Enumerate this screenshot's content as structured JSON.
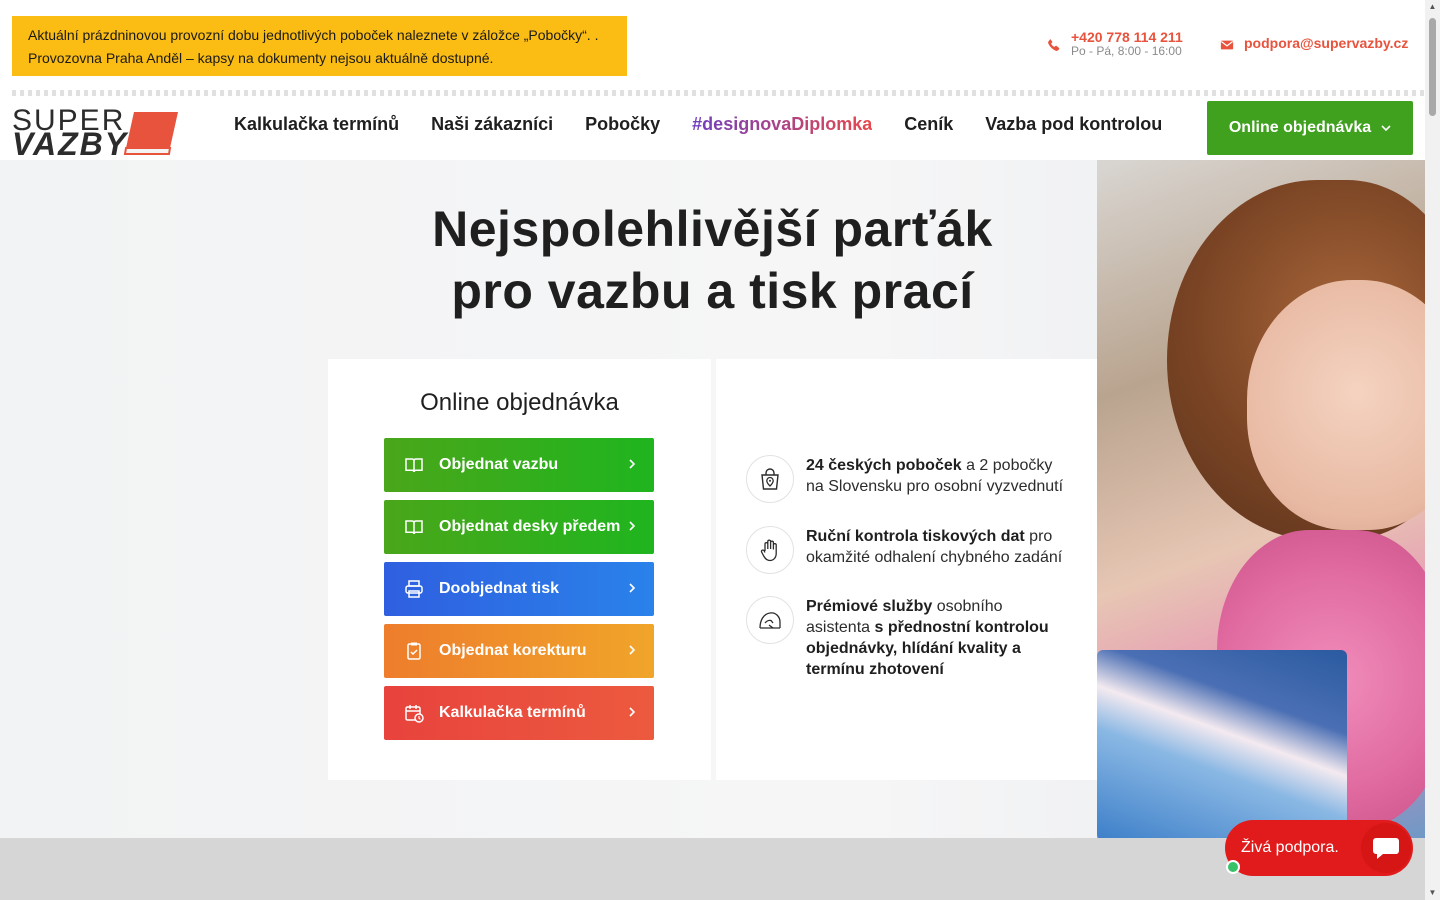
{
  "notice": {
    "line1": "Aktuální prázdninovou provozní dobu jednotlivých poboček naleznete v záložce „Pobočky“. .",
    "line2": "Provozovna Praha Anděl – kapsy na dokumenty nejsou aktuálně dostupné."
  },
  "contact": {
    "phone": "+420 778 114 211",
    "hours": "Po - Pá, 8:00 - 16:00",
    "email": "podpora@supervazby.cz"
  },
  "logo": {
    "line1": "SUPER",
    "line2": "VAZBY"
  },
  "nav": {
    "items": [
      "Kalkulačka termínů",
      "Naši zákazníci",
      "Pobočky",
      "#designovaDiplomka",
      "Ceník",
      "Vazba pod kontrolou"
    ],
    "order_button": "Online objednávka"
  },
  "hero": {
    "title_line1": "Nejspolehlivější parťák",
    "title_line2": "pro vazbu a tisk prací"
  },
  "order_card": {
    "heading": "Online objednávka",
    "buttons": [
      {
        "label": "Objednat vazbu",
        "icon": "book-open-icon",
        "color": "#3fa11e"
      },
      {
        "label": "Objednat desky předem",
        "icon": "book-open-icon",
        "color": "#3fa11e"
      },
      {
        "label": "Doobjednat tisk",
        "icon": "printer-icon",
        "color": "#2f6ee0"
      },
      {
        "label": "Objednat korekturu",
        "icon": "clipboard-check-icon",
        "color": "#ef8a2a"
      },
      {
        "label": "Kalkulačka termínů",
        "icon": "calendar-clock-icon",
        "color": "#e84c3d"
      }
    ]
  },
  "features": [
    {
      "icon": "bag-location-icon",
      "bold": "24 českých poboček",
      "text": " a 2 pobočky na Slovensku pro osobní vyzvednutí"
    },
    {
      "icon": "hand-icon",
      "bold": "Ruční kontrola tiskových dat",
      "text": " pro okamžité odhalení chybného zadání"
    },
    {
      "icon": "assistant-icon",
      "bold": "Prémiové služby",
      "text": " osobního asistenta ",
      "bold2": "s přednostní kontrolou objednávky, hlídání kvality a termínu zhotovení"
    }
  ],
  "chat": {
    "label": "Živá podpora."
  },
  "colors": {
    "notice_bg": "#fbbd14",
    "accent_red": "#e8533d",
    "green": "#3fa11e",
    "blue": "#2f6ee0",
    "orange": "#ef8a2a",
    "chat_red": "#e11b1b"
  }
}
